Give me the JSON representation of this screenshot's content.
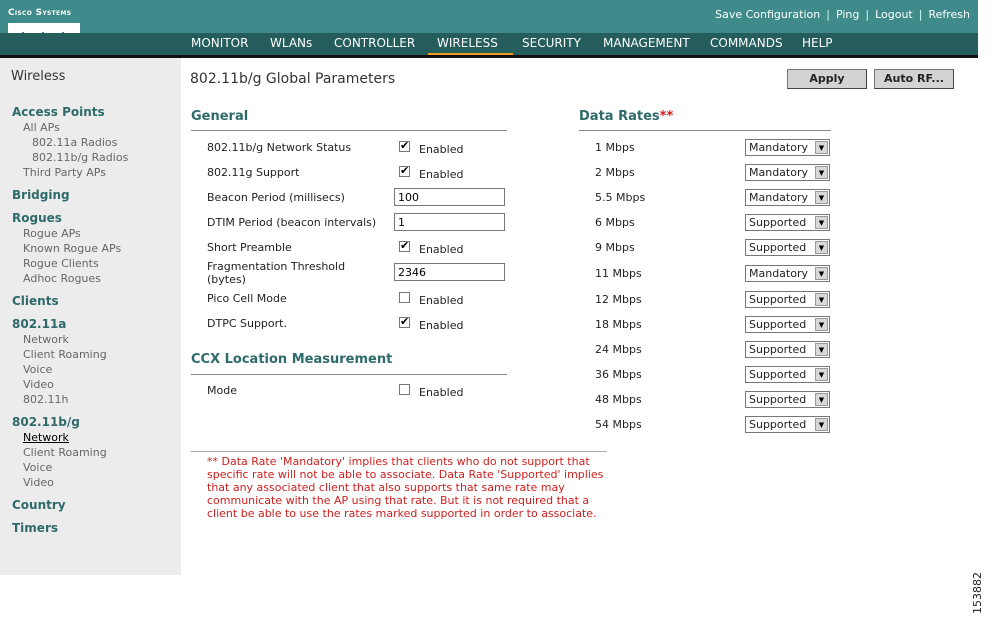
{
  "header": {
    "logo_text": "Cisco Systems",
    "links": [
      "Save Configuration",
      "Ping",
      "Logout",
      "Refresh"
    ],
    "nav": [
      "MONITOR",
      "WLANs",
      "CONTROLLER",
      "WIRELESS",
      "SECURITY",
      "MANAGEMENT",
      "COMMANDS",
      "HELP"
    ],
    "active_nav": "WIRELESS",
    "accent_color": "#f39a1f",
    "bar_color": "#3f8a8a",
    "nav_color": "#255c5c"
  },
  "sidebar": {
    "title": "Wireless",
    "groups": [
      {
        "label": "Access Points",
        "items": [
          "All APs",
          "802.11a Radios",
          "802.11b/g Radios",
          "Third Party APs"
        ]
      },
      {
        "label": "Bridging"
      },
      {
        "label": "Rogues",
        "items": [
          "Rogue APs",
          "Known Rogue APs",
          "Rogue Clients",
          "Adhoc Rogues"
        ]
      },
      {
        "label": "Clients"
      },
      {
        "label": "802.11a",
        "items": [
          "Network",
          "Client Roaming",
          "Voice",
          "Video",
          "802.11h"
        ]
      },
      {
        "label": "802.11b/g",
        "items": [
          "Network",
          "Client Roaming",
          "Voice",
          "Video"
        ],
        "active_item": "Network"
      },
      {
        "label": "Country"
      },
      {
        "label": "Timers"
      }
    ]
  },
  "main": {
    "title": "802.11b/g Global Parameters",
    "apply_label": "Apply",
    "autorf_label": "Auto RF...",
    "general": {
      "heading": "General",
      "network_status_label": "802.11b/g Network Status",
      "network_status_checked": true,
      "g_support_label": "802.11g Support",
      "g_support_checked": true,
      "beacon_label": "Beacon Period (millisecs)",
      "beacon_value": "100",
      "dtim_label": "DTIM Period (beacon intervals)",
      "dtim_value": "1",
      "short_preamble_label": "Short Preamble",
      "short_preamble_checked": true,
      "frag_label_1": "Fragmentation Threshold",
      "frag_label_2": "(bytes)",
      "frag_value": "2346",
      "pico_label": "Pico Cell Mode",
      "pico_checked": false,
      "dtpc_label": "DTPC Support.",
      "dtpc_checked": true,
      "enabled_label": "Enabled"
    },
    "ccx": {
      "heading": "CCX Location Measurement",
      "mode_label": "Mode",
      "mode_checked": false,
      "enabled_label": "Enabled"
    },
    "data_rates": {
      "heading": "Data Rates",
      "heading_marker": "**",
      "rates": [
        {
          "rate": "1 Mbps",
          "value": "Mandatory"
        },
        {
          "rate": "2 Mbps",
          "value": "Mandatory"
        },
        {
          "rate": "5.5 Mbps",
          "value": "Mandatory"
        },
        {
          "rate": "6 Mbps",
          "value": "Supported"
        },
        {
          "rate": "9 Mbps",
          "value": "Supported"
        },
        {
          "rate": "11 Mbps",
          "value": "Mandatory"
        },
        {
          "rate": "12 Mbps",
          "value": "Supported"
        },
        {
          "rate": "18 Mbps",
          "value": "Supported"
        },
        {
          "rate": "24 Mbps",
          "value": "Supported"
        },
        {
          "rate": "36 Mbps",
          "value": "Supported"
        },
        {
          "rate": "48 Mbps",
          "value": "Supported"
        },
        {
          "rate": "54 Mbps",
          "value": "Supported"
        }
      ]
    },
    "note": "** Data Rate 'Mandatory' implies that clients who do not support that specific rate will not be able to associate. Data Rate 'Supported' implies that any associated client that also supports that same rate may communicate with the AP using that rate. But it is not required that a client be able to use the rates marked supported in order to associate."
  },
  "figure_id": "153882"
}
